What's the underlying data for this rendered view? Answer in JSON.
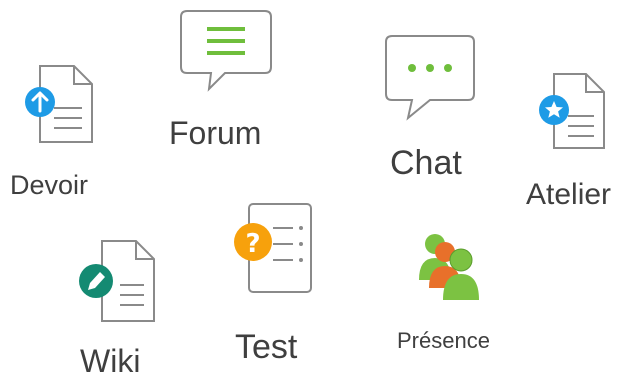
{
  "activities": [
    {
      "label": "Devoir",
      "icon": "assignment-upload-icon"
    },
    {
      "label": "Forum",
      "icon": "forum-icon"
    },
    {
      "label": "Chat",
      "icon": "chat-icon"
    },
    {
      "label": "Atelier",
      "icon": "workshop-icon"
    },
    {
      "label": "Wiki",
      "icon": "wiki-icon"
    },
    {
      "label": "Test",
      "icon": "quiz-icon"
    },
    {
      "label": "Présence",
      "icon": "attendance-icon"
    }
  ],
  "colors": {
    "doc_outline": "#8a8a8a",
    "doc_fill": "#ffffff",
    "upload_badge": "#1e9be6",
    "star_badge": "#1e9be6",
    "wiki_badge": "#148a72",
    "quiz_badge": "#f7a10c",
    "forum_lines": "#6fbe3c",
    "chat_dots": "#6fbe3c",
    "label_text": "#3f3f3f",
    "attendance_green": "#7cc242",
    "attendance_orange": "#e8702a"
  }
}
